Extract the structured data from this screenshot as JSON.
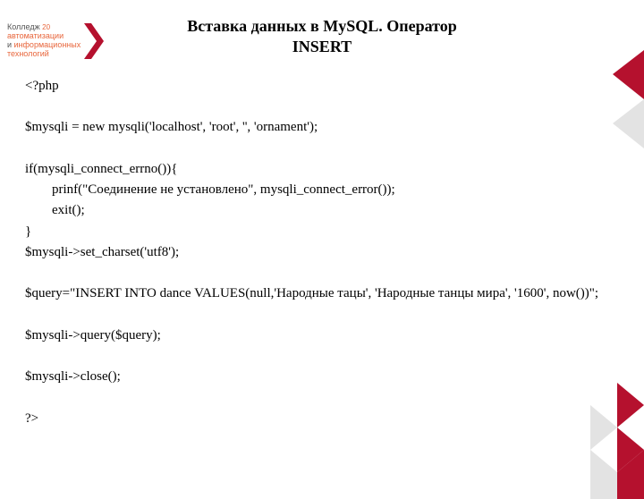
{
  "logo": {
    "line1_a": "Колледж",
    "line1_num": "20",
    "line2_a": "автоматизации",
    "line3_a": "и ",
    "line3_b": "информационных",
    "line4_a": "технологий"
  },
  "title": {
    "line1": "Вставка данных в MySQL. Оператор",
    "line2": "INSERT"
  },
  "code": "<?php\n\n$mysqli = new mysqli('localhost', 'root', '', 'ornament');\n\nif(mysqli_connect_errno()){\n        prinf(\"Соединение не установлено\", mysqli_connect_error());\n        exit();\n}\n$mysqli->set_charset('utf8');\n\n$query=\"INSERT INTO dance VALUES(null,'Народные тацы', 'Народные танцы мира', '1600', now())\";\n\n$mysqli->query($query);\n\n$mysqli->close();\n\n?>"
}
